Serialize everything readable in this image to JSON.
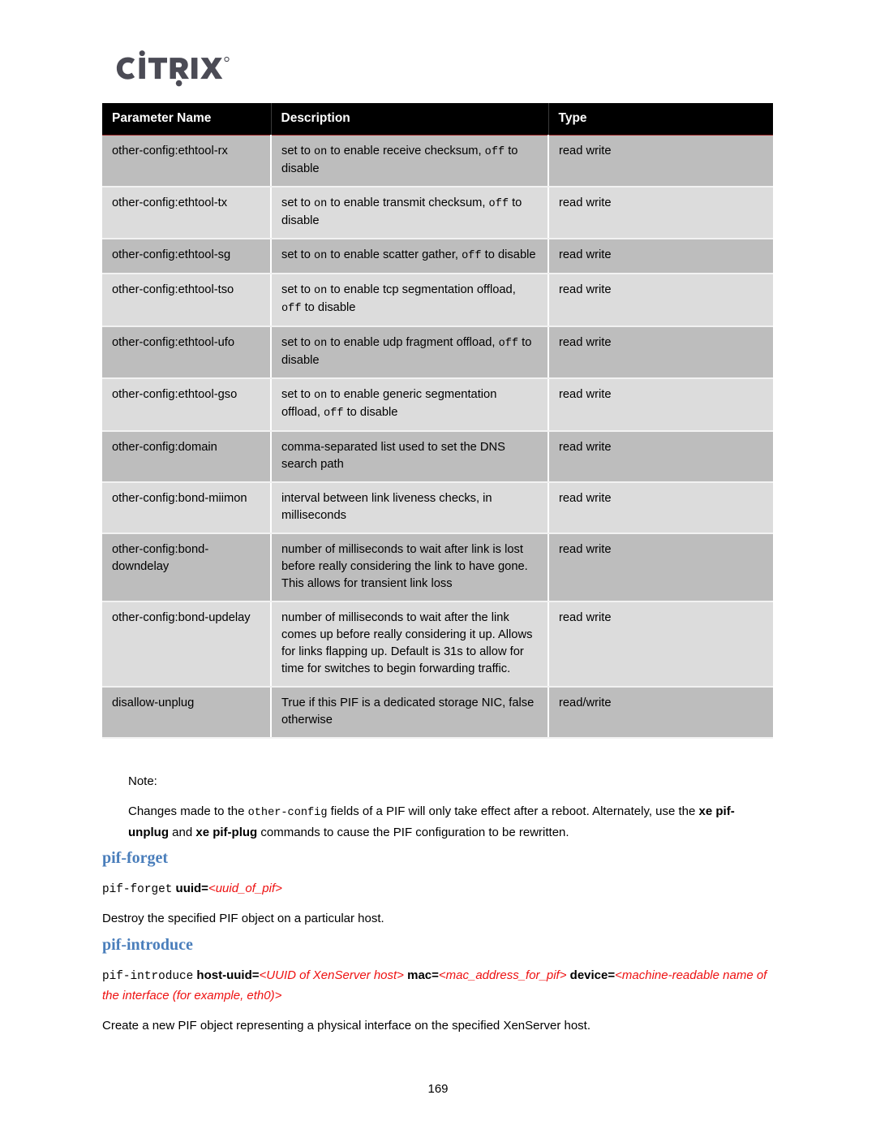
{
  "brand": {
    "logo_text": "CITRIX",
    "logo_color": "#4b4b55",
    "trademark": "®"
  },
  "table": {
    "headers": [
      "Parameter Name",
      "Description",
      "Type"
    ],
    "rows": [
      {
        "name": "other-config:ethtool-rx",
        "desc_parts": [
          {
            "t": "set to ",
            "m": false
          },
          {
            "t": "on",
            "m": true
          },
          {
            "t": " to enable receive checksum, ",
            "m": false
          },
          {
            "t": "off",
            "m": true
          },
          {
            "t": " to disable",
            "m": false
          }
        ],
        "type": "read write"
      },
      {
        "name": "other-config:ethtool-tx",
        "desc_parts": [
          {
            "t": "set to ",
            "m": false
          },
          {
            "t": "on",
            "m": true
          },
          {
            "t": " to enable transmit checksum, ",
            "m": false
          },
          {
            "t": "off",
            "m": true
          },
          {
            "t": " to disable",
            "m": false
          }
        ],
        "type": "read write"
      },
      {
        "name": "other-config:ethtool-sg",
        "desc_parts": [
          {
            "t": "set to ",
            "m": false
          },
          {
            "t": "on",
            "m": true
          },
          {
            "t": " to enable scatter gather, ",
            "m": false
          },
          {
            "t": "off",
            "m": true
          },
          {
            "t": " to disable",
            "m": false
          }
        ],
        "type": "read write"
      },
      {
        "name": "other-config:ethtool-tso",
        "desc_parts": [
          {
            "t": "set to ",
            "m": false
          },
          {
            "t": "on",
            "m": true
          },
          {
            "t": " to enable tcp segmentation offload, ",
            "m": false
          },
          {
            "t": "off",
            "m": true
          },
          {
            "t": " to disable",
            "m": false
          }
        ],
        "type": "read write"
      },
      {
        "name": "other-config:ethtool-ufo",
        "desc_parts": [
          {
            "t": "set to ",
            "m": false
          },
          {
            "t": "on",
            "m": true
          },
          {
            "t": " to enable udp fragment offload, ",
            "m": false
          },
          {
            "t": "off",
            "m": true
          },
          {
            "t": " to disable",
            "m": false
          }
        ],
        "type": "read write"
      },
      {
        "name": "other-config:ethtool-gso",
        "desc_parts": [
          {
            "t": "set to ",
            "m": false
          },
          {
            "t": "on",
            "m": true
          },
          {
            "t": " to enable generic segmentation offload, ",
            "m": false
          },
          {
            "t": "off",
            "m": true
          },
          {
            "t": " to disable",
            "m": false
          }
        ],
        "type": "read write"
      },
      {
        "name": "other-config:domain",
        "desc_parts": [
          {
            "t": "comma-separated list used to set the DNS search path",
            "m": false
          }
        ],
        "type": "read write"
      },
      {
        "name": "other-config:bond-miimon",
        "desc_parts": [
          {
            "t": "interval between link liveness checks, in milliseconds",
            "m": false
          }
        ],
        "type": "read write"
      },
      {
        "name": "other-config:bond-downdelay",
        "desc_parts": [
          {
            "t": "number of milliseconds to wait after link is lost before really considering the link to have gone. This allows for transient link loss",
            "m": false
          }
        ],
        "type": "read write"
      },
      {
        "name": "other-config:bond-updelay",
        "desc_parts": [
          {
            "t": "number of milliseconds to wait after the link comes up before really considering it up. Allows for links flapping up. Default is 31s to allow for time for switches to begin forwarding traffic.",
            "m": false
          }
        ],
        "type": "read write"
      },
      {
        "name": "disallow-unplug",
        "desc_parts": [
          {
            "t": "True if this PIF is a dedicated storage NIC, false otherwise",
            "m": false
          }
        ],
        "type": "read/write"
      }
    ]
  },
  "note": {
    "label": "Note:",
    "body_parts": [
      {
        "t": "Changes made to the ",
        "style": "normal"
      },
      {
        "t": "other-config",
        "style": "mono"
      },
      {
        "t": " fields of a PIF will only take effect after a reboot. Alternately, use the ",
        "style": "normal"
      },
      {
        "t": "xe pif-unplug",
        "style": "bold"
      },
      {
        "t": " and ",
        "style": "normal"
      },
      {
        "t": "xe pif-plug",
        "style": "bold"
      },
      {
        "t": " commands to cause the PIF configuration to be rewritten.",
        "style": "normal"
      }
    ]
  },
  "sections": [
    {
      "heading": "pif-forget",
      "command_parts": [
        {
          "t": "pif-forget",
          "style": "cmdname"
        },
        {
          "t": " uuid=",
          "style": "arg"
        },
        {
          "t": "<uuid_of_pif>",
          "style": "placeholder"
        }
      ],
      "paragraph": "Destroy the specified PIF object on a particular host."
    },
    {
      "heading": "pif-introduce",
      "command_parts": [
        {
          "t": "pif-introduce",
          "style": "cmdname"
        },
        {
          "t": " host-uuid=",
          "style": "arg"
        },
        {
          "t": "<UUID of XenServer host>",
          "style": "placeholder"
        },
        {
          "t": " mac=",
          "style": "arg"
        },
        {
          "t": "<mac_address_for_pif>",
          "style": "placeholder"
        },
        {
          "t": " device=",
          "style": "arg"
        },
        {
          "t": "<machine-readable name of the interface (for example, eth0)>",
          "style": "placeholder"
        }
      ],
      "paragraph": "Create a new PIF object representing a physical interface on the specified XenServer host."
    }
  ],
  "footer": {
    "page_number": "169"
  },
  "colors": {
    "header_bg": "#000000",
    "row_dark": "#bdbdbd",
    "row_light": "#dcdcdc",
    "heading_blue": "#4a7ebb",
    "placeholder_red": "#ee1111",
    "header_underline": "#a03030"
  }
}
